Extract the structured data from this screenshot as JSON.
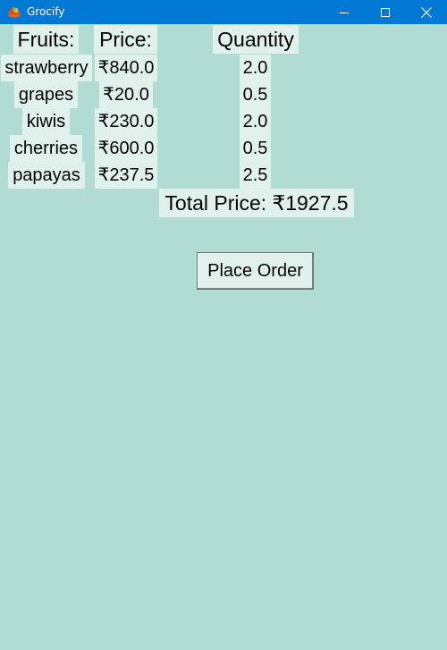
{
  "window": {
    "title": "Grocify",
    "minimize_glyph": "—",
    "maximize_glyph": "☐",
    "close_glyph": "✕"
  },
  "headers": {
    "fruits": "Fruits:",
    "price": "Price:",
    "quantity": "Quantity"
  },
  "rows": [
    {
      "fruit": "strawberry",
      "price": "₹840.0",
      "quantity": "2.0"
    },
    {
      "fruit": "grapes",
      "price": "₹20.0",
      "quantity": "0.5"
    },
    {
      "fruit": "kiwis",
      "price": "₹230.0",
      "quantity": "2.0"
    },
    {
      "fruit": "cherries",
      "price": "₹600.0",
      "quantity": "0.5"
    },
    {
      "fruit": "papayas",
      "price": "₹237.5",
      "quantity": "2.5"
    }
  ],
  "total": "Total Price: ₹1927.5",
  "actions": {
    "place_order": "Place Order"
  },
  "colors": {
    "window_bg": "#b0dcd3",
    "cell_bg": "#e0f1ec",
    "titlebar_bg": "#0078d4"
  }
}
